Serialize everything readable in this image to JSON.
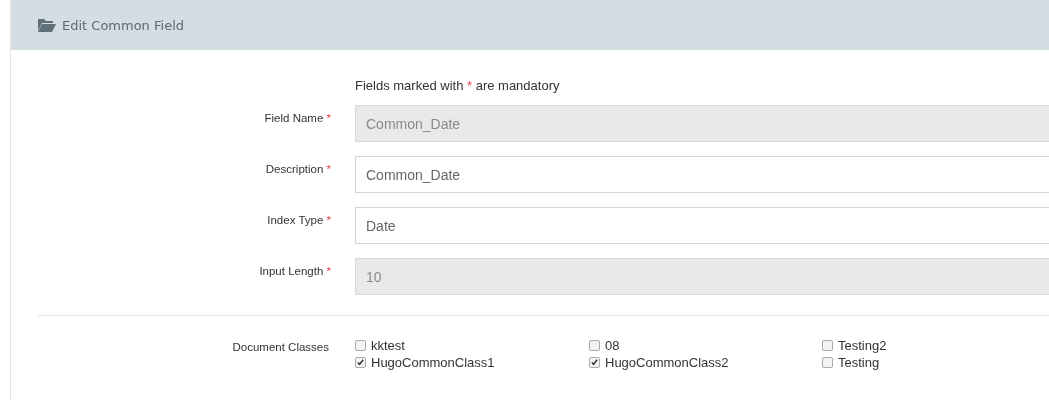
{
  "panel": {
    "title": "Edit Common Field"
  },
  "mandatory_note": {
    "before": "Fields marked with",
    "marker": "*",
    "after": "are mandatory"
  },
  "fields": [
    {
      "label": "Field Name",
      "required": true,
      "value": "Common_Date",
      "disabled": true
    },
    {
      "label": "Description",
      "required": true,
      "value": "Common_Date",
      "disabled": false
    },
    {
      "label": "Index Type",
      "required": true,
      "value": "Date",
      "disabled": false
    },
    {
      "label": "Input Length",
      "required": true,
      "value": "10",
      "disabled": true
    }
  ],
  "document_classes": {
    "label": "Document Classes",
    "items": [
      {
        "label": "kktest",
        "checked": false
      },
      {
        "label": "08",
        "checked": false
      },
      {
        "label": "Testing2",
        "checked": false
      },
      {
        "label": "HugoCommonClass1",
        "checked": true
      },
      {
        "label": "HugoCommonClass2",
        "checked": true
      },
      {
        "label": "Testing",
        "checked": false
      }
    ]
  }
}
